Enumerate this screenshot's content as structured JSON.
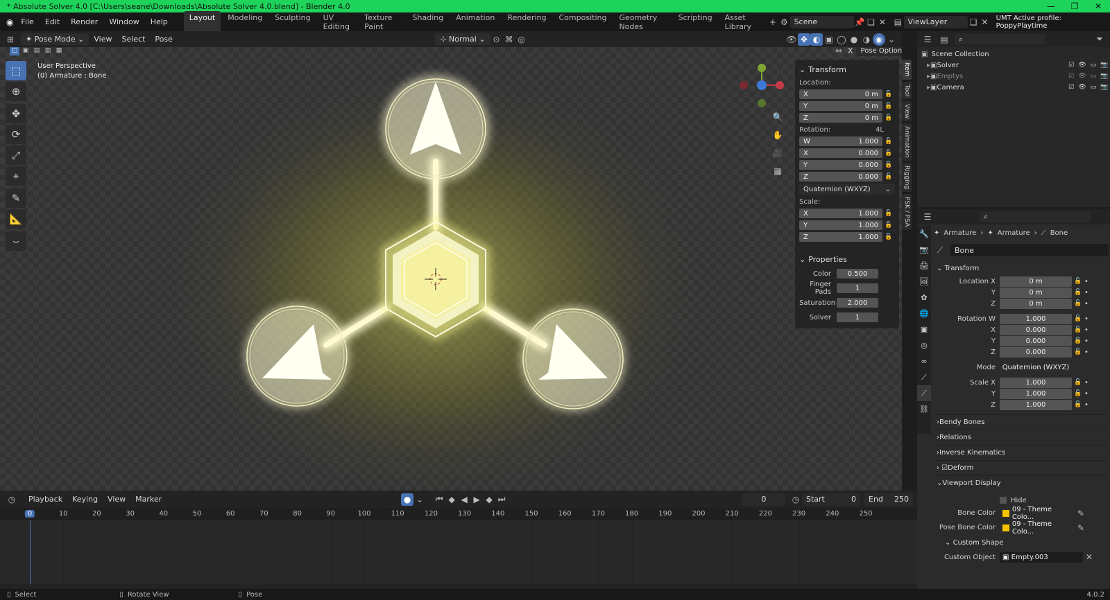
{
  "window": {
    "title": "* Absolute Solver 4.0 [C:\\Users\\seane\\Downloads\\Absolute Solver 4.0.blend] - Blender 4.0"
  },
  "menu": [
    "File",
    "Edit",
    "Render",
    "Window",
    "Help"
  ],
  "workspaces": [
    "Layout",
    "Modeling",
    "Sculpting",
    "UV Editing",
    "Texture Paint",
    "Shading",
    "Animation",
    "Rendering",
    "Compositing",
    "Geometry Nodes",
    "Scripting",
    "Asset Library"
  ],
  "scene": {
    "name": "Scene",
    "view_layer": "ViewLayer",
    "profile": "UMT Active profile: PoppyPlaytime"
  },
  "viewport_header": {
    "mode": "Pose Mode",
    "view": "View",
    "select": "Select",
    "pose": "Pose",
    "orientation": "Normal",
    "pose_options": "Pose Options"
  },
  "viewport": {
    "perspective": "User Perspective",
    "active": "(0) Armature : Bone",
    "glow": "#f1f27a"
  },
  "npanel": {
    "tabs": [
      "Item",
      "Tool",
      "View",
      "Animation",
      "Rigging",
      "PSK / PSA"
    ],
    "transform": "Transform",
    "location_label": "Location:",
    "location": [
      {
        "k": "X",
        "v": "0 m"
      },
      {
        "k": "Y",
        "v": "0 m"
      },
      {
        "k": "Z",
        "v": "0 m"
      }
    ],
    "rotation_label": "Rotation:",
    "rotation_badge": "4L",
    "rotation": [
      {
        "k": "W",
        "v": "1.000"
      },
      {
        "k": "X",
        "v": "0.000"
      },
      {
        "k": "Y",
        "v": "0.000"
      },
      {
        "k": "Z",
        "v": "0.000"
      }
    ],
    "rotation_mode": "Quaternion (WXYZ)",
    "scale_label": "Scale:",
    "scale": [
      {
        "k": "X",
        "v": "1.000"
      },
      {
        "k": "Y",
        "v": "1.000"
      },
      {
        "k": "Z",
        "v": "1.000"
      }
    ],
    "properties": "Properties",
    "props": [
      {
        "k": "Color",
        "v": "0.500"
      },
      {
        "k": "Finger Pads",
        "v": "1"
      },
      {
        "k": "Saturation",
        "v": "2.000"
      },
      {
        "k": "Solver",
        "v": "1"
      }
    ]
  },
  "outliner": {
    "root": "Scene Collection",
    "items": [
      "Solver",
      "Emptys",
      "Camera"
    ]
  },
  "properties": {
    "breadcrumb": [
      "Armature",
      "Armature",
      "Bone"
    ],
    "bone_name": "Bone",
    "transform": "Transform",
    "rows": [
      {
        "l": "Location X",
        "v": "0 m"
      },
      {
        "l": "Y",
        "v": "0 m"
      },
      {
        "l": "Z",
        "v": "0 m"
      },
      {
        "l": "Rotation W",
        "v": "1.000"
      },
      {
        "l": "X",
        "v": "0.000"
      },
      {
        "l": "Y",
        "v": "0.000"
      },
      {
        "l": "Z",
        "v": "0.000"
      },
      {
        "l": "Mode",
        "v": "Quaternion (WXYZ)"
      },
      {
        "l": "Scale X",
        "v": "1.000"
      },
      {
        "l": "Y",
        "v": "1.000"
      },
      {
        "l": "Z",
        "v": "1.000"
      }
    ],
    "sections": [
      "Bendy Bones",
      "Relations",
      "Inverse Kinematics",
      "Deform",
      "Viewport Display"
    ],
    "hide": "Hide",
    "bone_color_label": "Bone Color",
    "bone_color": "09 - Theme Colo...",
    "pose_bone_color_label": "Pose Bone Color",
    "pose_bone_color": "09 - Theme Colo...",
    "custom_shape": "Custom Shape",
    "custom_object_label": "Custom Object",
    "custom_object": "Empty.003"
  },
  "timeline": {
    "menus": [
      "Playback",
      "Keying",
      "View",
      "Marker"
    ],
    "current": "0",
    "start_label": "Start",
    "start": "0",
    "end_label": "End",
    "end": "250",
    "ticks": [
      "0",
      "10",
      "20",
      "30",
      "40",
      "50",
      "60",
      "70",
      "80",
      "90",
      "100",
      "110",
      "120",
      "130",
      "140",
      "150",
      "160",
      "170",
      "180",
      "190",
      "200",
      "210",
      "220",
      "230",
      "240",
      "250"
    ]
  },
  "status": {
    "select": "Select",
    "rotate": "Rotate View",
    "pose": "Pose",
    "version": "4.0.2"
  }
}
